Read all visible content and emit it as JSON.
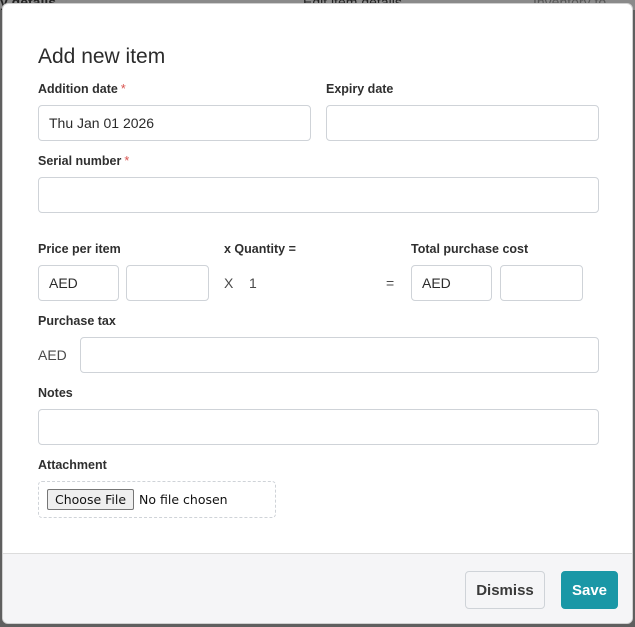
{
  "background": {
    "left_text": "y details",
    "middle_text": "Edit item details",
    "right_text": "Inventory to"
  },
  "modal": {
    "title": "Add new item",
    "addition_date": {
      "label": "Addition date",
      "required_mark": "*",
      "value": "Thu Jan 01 2026"
    },
    "expiry_date": {
      "label": "Expiry date",
      "value": ""
    },
    "serial_number": {
      "label": "Serial number",
      "required_mark": "*",
      "value": ""
    },
    "price_per_item": {
      "label": "Price per item",
      "currency": "AED",
      "value": ""
    },
    "quantity": {
      "label": "x Quantity =",
      "operator": "X",
      "value": "1"
    },
    "total_purchase_cost": {
      "label": "Total purchase cost",
      "equals": "=",
      "currency": "AED",
      "value": ""
    },
    "purchase_tax": {
      "label": "Purchase tax",
      "currency": "AED",
      "value": ""
    },
    "notes": {
      "label": "Notes",
      "value": ""
    },
    "attachment": {
      "label": "Attachment",
      "button_label": "Choose File",
      "status": "No file chosen"
    }
  },
  "footer": {
    "dismiss_label": "Dismiss",
    "save_label": "Save"
  },
  "colors": {
    "accent": "#1a97a6",
    "required": "#d9534f"
  }
}
